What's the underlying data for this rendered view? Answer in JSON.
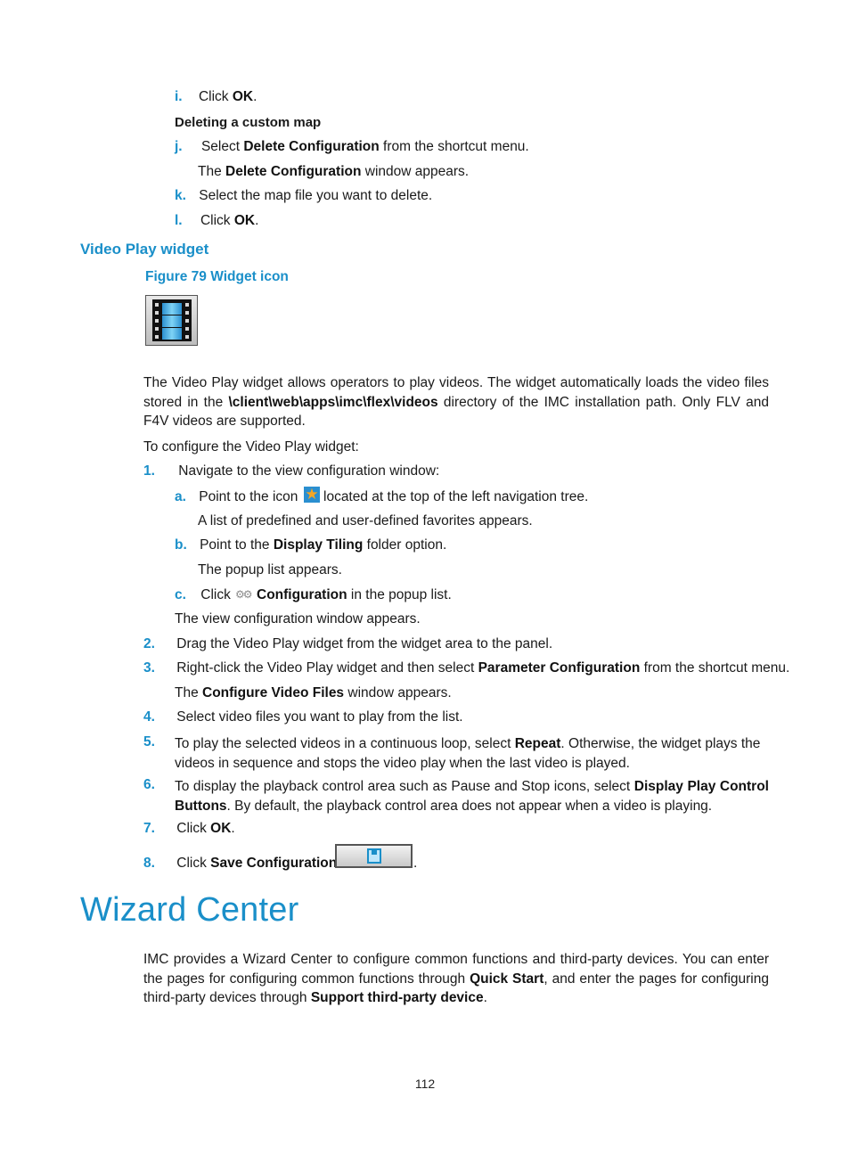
{
  "top_steps": [
    {
      "label": "i.",
      "pre": "Click ",
      "bold": "OK",
      "post": "."
    },
    {
      "heading": "Deleting a custom map"
    },
    {
      "label": "j.",
      "pre": "Select ",
      "bold": "Delete Configuration",
      "post": " from the shortcut menu."
    },
    {
      "sub_pre": "The ",
      "sub_bold": "Delete Configuration",
      "sub_post": " window appears."
    },
    {
      "label": "k.",
      "text": "Select the map file you want to delete."
    },
    {
      "label": "l.",
      "pre": "Click ",
      "bold": "OK",
      "post": "."
    }
  ],
  "section": {
    "heading": "Video Play widget",
    "figure_caption": "Figure 79 Widget icon",
    "figure_icon": "film-strip-icon",
    "intro": {
      "pre": "The Video Play widget allows operators to play videos. The widget automatically loads the video files stored in the ",
      "bold": "\\client\\web\\apps\\imc\\flex\\videos",
      "post": " directory of the IMC installation path. Only FLV and F4V videos are supported."
    },
    "configure_intro": "To configure the Video Play widget:",
    "steps": {
      "s1": {
        "label": "1.",
        "text": "Navigate to the view configuration window:"
      },
      "a": {
        "label": "a.",
        "pre": "Point to the icon ",
        "icon": "favorites-star-icon",
        "post": "located at the top of the left navigation tree."
      },
      "a_note": "A list of predefined and user-defined favorites appears.",
      "b": {
        "label": "b.",
        "pre": "Point to the ",
        "bold": "Display Tiling",
        "post": " folder option."
      },
      "b_note": "The popup list appears.",
      "c": {
        "label": "c.",
        "pre": "Click ",
        "icon": "gears-icon",
        "bold": "Configuration",
        "post": " in the popup list."
      },
      "s1_note": "The view configuration window appears.",
      "s2": {
        "label": "2.",
        "text": "Drag the Video Play widget from the widget area to the panel."
      },
      "s3": {
        "label": "3.",
        "pre": "Right-click the Video Play widget and then select ",
        "bold": "Parameter Configuration",
        "post": " from the shortcut menu."
      },
      "s3_note": {
        "pre": "The ",
        "bold": "Configure Video Files",
        "post": " window appears."
      },
      "s4": {
        "label": "4.",
        "text": "Select video files you want to play from the list."
      },
      "s5": {
        "label": "5.",
        "pre": "To play the selected videos in a continuous loop, select ",
        "bold": "Repeat",
        "post": ". Otherwise, the widget plays the",
        "line2": "videos in sequence and stops the video play when the last video is played."
      },
      "s6": {
        "label": "6.",
        "pre": "To display the playback control area such as Pause and Stop icons, select ",
        "bold": "Display Play Control",
        "bold2": "Buttons",
        "post": ". By default, the playback control area does not appear when a video is playing."
      },
      "s7": {
        "label": "7.",
        "pre": "Click ",
        "bold": "OK",
        "post": "."
      },
      "s8": {
        "label": "8.",
        "pre": "Click ",
        "bold": "Save Configuration",
        "icon": "save-configuration-button",
        "post": "."
      }
    }
  },
  "wizard": {
    "title": "Wizard Center",
    "body_pre": "IMC provides a Wizard Center to configure common functions and third-party devices. You can enter the pages for configuring common functions through ",
    "bold1": "Quick Start",
    "body_mid": ", and enter the pages for configuring third-party devices through ",
    "bold2": "Support third-party device",
    "body_post": "."
  },
  "page_number": "112"
}
